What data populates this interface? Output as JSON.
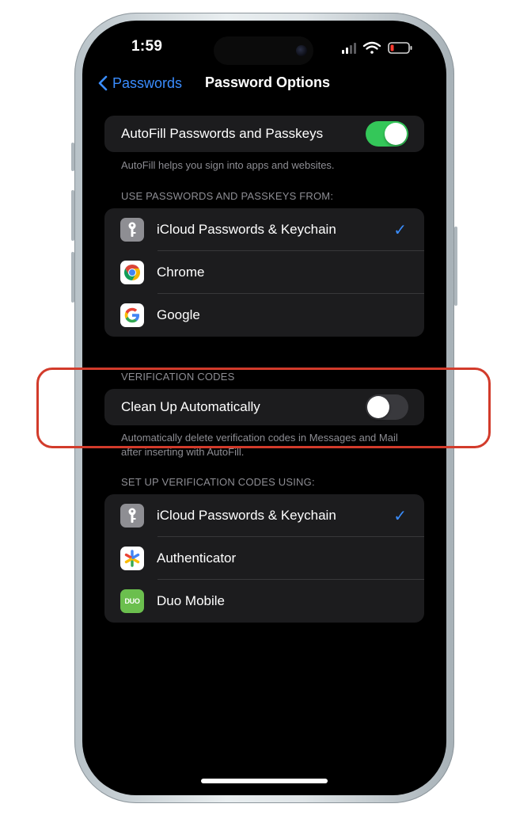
{
  "status_bar": {
    "time": "1:59",
    "icons": [
      "cellular-signal-icon",
      "wifi-icon",
      "battery-low-icon"
    ],
    "battery_color": "#ff3b30"
  },
  "nav": {
    "back_label": "Passwords",
    "title": "Password Options"
  },
  "autofill": {
    "label": "AutoFill Passwords and Passkeys",
    "enabled": true,
    "footnote": "AutoFill helps you sign into apps and websites."
  },
  "use_from": {
    "header": "USE PASSWORDS AND PASSKEYS FROM:",
    "items": [
      {
        "label": "iCloud Passwords & Keychain",
        "icon": "keychain-icon",
        "checked": true
      },
      {
        "label": "Chrome",
        "icon": "chrome-icon",
        "checked": false
      },
      {
        "label": "Google",
        "icon": "google-icon",
        "checked": false
      }
    ]
  },
  "verification": {
    "header": "VERIFICATION CODES",
    "cleanup_label": "Clean Up Automatically",
    "cleanup_enabled": false,
    "footnote": "Automatically delete verification codes in Messages and Mail after inserting with AutoFill."
  },
  "setup_codes": {
    "header": "SET UP VERIFICATION CODES USING:",
    "items": [
      {
        "label": "iCloud Passwords & Keychain",
        "icon": "keychain-icon",
        "checked": true
      },
      {
        "label": "Authenticator",
        "icon": "authenticator-icon",
        "checked": false
      },
      {
        "label": "Duo Mobile",
        "icon": "duo-icon",
        "checked": false
      }
    ]
  },
  "checkmark": "✓",
  "duo_icon_text": "DUO",
  "colors": {
    "accent": "#3a8dff",
    "toggle_on": "#34c759",
    "toggle_off": "#39393d",
    "highlight": "#d23b2b"
  }
}
